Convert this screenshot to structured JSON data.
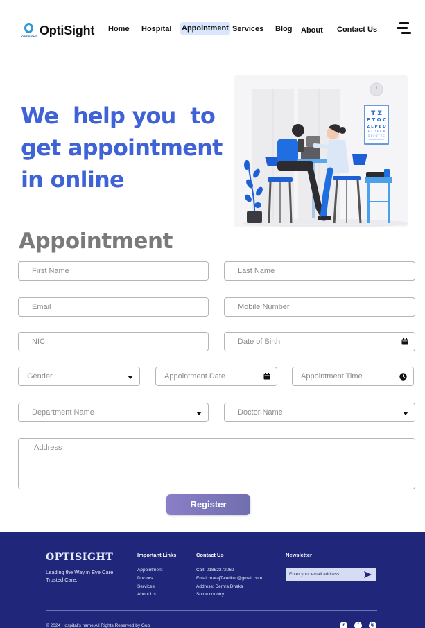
{
  "header": {
    "logo_text": "OptiSight",
    "logo_subtext": "OPTISIGHT",
    "nav": [
      {
        "label": "Home"
      },
      {
        "label": "Hospital"
      },
      {
        "label": "Appointment"
      },
      {
        "label": "Services"
      },
      {
        "label": "Blog"
      },
      {
        "label": "About"
      },
      {
        "label": "Contact Us"
      }
    ],
    "active_nav": "Appointment",
    "menu_icon": "hamburger-menu-icon"
  },
  "hero": {
    "title_lines": [
      "We  help you  to",
      "get appointment",
      "in online"
    ],
    "illustration": {
      "eye_chart": [
        "T Z",
        "P T O C",
        "Z L P E D",
        "E T O E C P",
        "D E F O T E C"
      ]
    }
  },
  "form": {
    "title": "Appointment",
    "first_name": "First Name",
    "last_name": "Last Name",
    "email": "Email",
    "mobile": "Mobile Number",
    "nic": "NIC",
    "dob": "Date of Birth",
    "gender": "Gender",
    "appointment_date": "Appointment Date",
    "appointment_time": "Appointment Time",
    "department": "Department Name",
    "doctor": "Doctor Name",
    "address": "Address",
    "register_label": "Register"
  },
  "footer": {
    "brand": "OPTISIGHT",
    "tagline": "Leading the Way in Eye Care Trusted Care.",
    "links_title": "Important Links",
    "links": [
      "Appointment",
      "Doctors",
      "Services",
      "About Us"
    ],
    "contact_title": "Contact Us",
    "contact": [
      "Call: 01852272062",
      "Email:marajTaludker@gmail.com",
      "Address: Demra,Dhaka",
      "Some country"
    ],
    "newsletter_title": "Newsletter",
    "newsletter_placeholder": "Enter your email address",
    "copyright": "© 2024 Hospital's name All Rights Reserved by Gub",
    "social": [
      "in",
      "f",
      "ig"
    ]
  },
  "colors": {
    "accent": "#3f63d6",
    "footer_bg": "#20267a",
    "button_start": "#8b7ec8",
    "button_end": "#6f6fae",
    "title_gray": "#7a7a7a"
  }
}
